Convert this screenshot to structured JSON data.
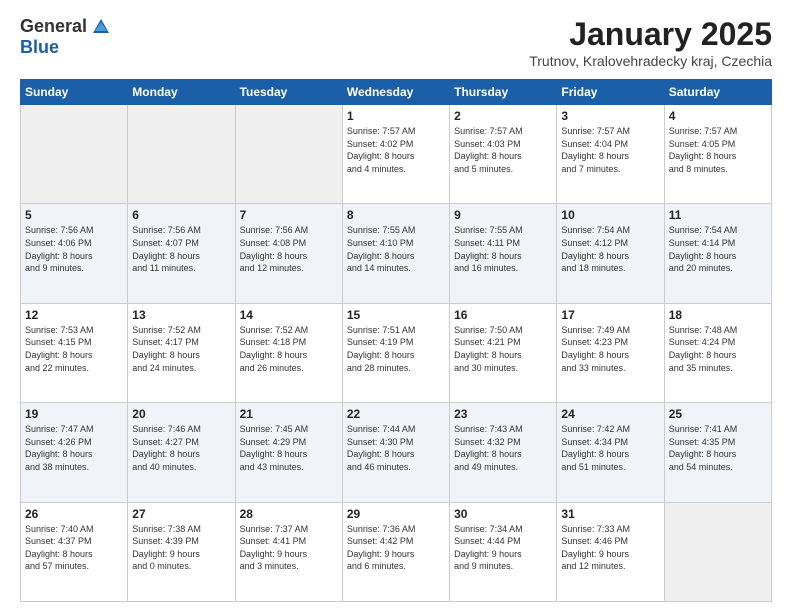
{
  "logo": {
    "general": "General",
    "blue": "Blue"
  },
  "title": "January 2025",
  "subtitle": "Trutnov, Kralovehradecky kraj, Czechia",
  "days_header": [
    "Sunday",
    "Monday",
    "Tuesday",
    "Wednesday",
    "Thursday",
    "Friday",
    "Saturday"
  ],
  "weeks": [
    [
      {
        "num": "",
        "info": ""
      },
      {
        "num": "",
        "info": ""
      },
      {
        "num": "",
        "info": ""
      },
      {
        "num": "1",
        "info": "Sunrise: 7:57 AM\nSunset: 4:02 PM\nDaylight: 8 hours\nand 4 minutes."
      },
      {
        "num": "2",
        "info": "Sunrise: 7:57 AM\nSunset: 4:03 PM\nDaylight: 8 hours\nand 5 minutes."
      },
      {
        "num": "3",
        "info": "Sunrise: 7:57 AM\nSunset: 4:04 PM\nDaylight: 8 hours\nand 7 minutes."
      },
      {
        "num": "4",
        "info": "Sunrise: 7:57 AM\nSunset: 4:05 PM\nDaylight: 8 hours\nand 8 minutes."
      }
    ],
    [
      {
        "num": "5",
        "info": "Sunrise: 7:56 AM\nSunset: 4:06 PM\nDaylight: 8 hours\nand 9 minutes."
      },
      {
        "num": "6",
        "info": "Sunrise: 7:56 AM\nSunset: 4:07 PM\nDaylight: 8 hours\nand 11 minutes."
      },
      {
        "num": "7",
        "info": "Sunrise: 7:56 AM\nSunset: 4:08 PM\nDaylight: 8 hours\nand 12 minutes."
      },
      {
        "num": "8",
        "info": "Sunrise: 7:55 AM\nSunset: 4:10 PM\nDaylight: 8 hours\nand 14 minutes."
      },
      {
        "num": "9",
        "info": "Sunrise: 7:55 AM\nSunset: 4:11 PM\nDaylight: 8 hours\nand 16 minutes."
      },
      {
        "num": "10",
        "info": "Sunrise: 7:54 AM\nSunset: 4:12 PM\nDaylight: 8 hours\nand 18 minutes."
      },
      {
        "num": "11",
        "info": "Sunrise: 7:54 AM\nSunset: 4:14 PM\nDaylight: 8 hours\nand 20 minutes."
      }
    ],
    [
      {
        "num": "12",
        "info": "Sunrise: 7:53 AM\nSunset: 4:15 PM\nDaylight: 8 hours\nand 22 minutes."
      },
      {
        "num": "13",
        "info": "Sunrise: 7:52 AM\nSunset: 4:17 PM\nDaylight: 8 hours\nand 24 minutes."
      },
      {
        "num": "14",
        "info": "Sunrise: 7:52 AM\nSunset: 4:18 PM\nDaylight: 8 hours\nand 26 minutes."
      },
      {
        "num": "15",
        "info": "Sunrise: 7:51 AM\nSunset: 4:19 PM\nDaylight: 8 hours\nand 28 minutes."
      },
      {
        "num": "16",
        "info": "Sunrise: 7:50 AM\nSunset: 4:21 PM\nDaylight: 8 hours\nand 30 minutes."
      },
      {
        "num": "17",
        "info": "Sunrise: 7:49 AM\nSunset: 4:23 PM\nDaylight: 8 hours\nand 33 minutes."
      },
      {
        "num": "18",
        "info": "Sunrise: 7:48 AM\nSunset: 4:24 PM\nDaylight: 8 hours\nand 35 minutes."
      }
    ],
    [
      {
        "num": "19",
        "info": "Sunrise: 7:47 AM\nSunset: 4:26 PM\nDaylight: 8 hours\nand 38 minutes."
      },
      {
        "num": "20",
        "info": "Sunrise: 7:46 AM\nSunset: 4:27 PM\nDaylight: 8 hours\nand 40 minutes."
      },
      {
        "num": "21",
        "info": "Sunrise: 7:45 AM\nSunset: 4:29 PM\nDaylight: 8 hours\nand 43 minutes."
      },
      {
        "num": "22",
        "info": "Sunrise: 7:44 AM\nSunset: 4:30 PM\nDaylight: 8 hours\nand 46 minutes."
      },
      {
        "num": "23",
        "info": "Sunrise: 7:43 AM\nSunset: 4:32 PM\nDaylight: 8 hours\nand 49 minutes."
      },
      {
        "num": "24",
        "info": "Sunrise: 7:42 AM\nSunset: 4:34 PM\nDaylight: 8 hours\nand 51 minutes."
      },
      {
        "num": "25",
        "info": "Sunrise: 7:41 AM\nSunset: 4:35 PM\nDaylight: 8 hours\nand 54 minutes."
      }
    ],
    [
      {
        "num": "26",
        "info": "Sunrise: 7:40 AM\nSunset: 4:37 PM\nDaylight: 8 hours\nand 57 minutes."
      },
      {
        "num": "27",
        "info": "Sunrise: 7:38 AM\nSunset: 4:39 PM\nDaylight: 9 hours\nand 0 minutes."
      },
      {
        "num": "28",
        "info": "Sunrise: 7:37 AM\nSunset: 4:41 PM\nDaylight: 9 hours\nand 3 minutes."
      },
      {
        "num": "29",
        "info": "Sunrise: 7:36 AM\nSunset: 4:42 PM\nDaylight: 9 hours\nand 6 minutes."
      },
      {
        "num": "30",
        "info": "Sunrise: 7:34 AM\nSunset: 4:44 PM\nDaylight: 9 hours\nand 9 minutes."
      },
      {
        "num": "31",
        "info": "Sunrise: 7:33 AM\nSunset: 4:46 PM\nDaylight: 9 hours\nand 12 minutes."
      },
      {
        "num": "",
        "info": ""
      }
    ]
  ]
}
